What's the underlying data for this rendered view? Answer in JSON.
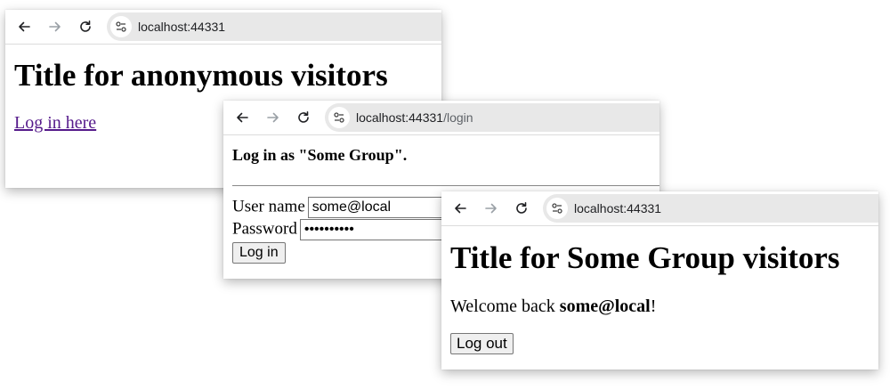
{
  "windows": {
    "anonymous": {
      "url_host": "localhost:44331",
      "url_path": "",
      "title": "Title for anonymous visitors",
      "login_link": "Log in here"
    },
    "login": {
      "url_host": "localhost:44331",
      "url_path": "/login",
      "heading": "Log in as \"Some Group\".",
      "username_label": "User name",
      "username_value": "some@local",
      "password_label": "Password",
      "password_value": "••••••••••",
      "submit_label": "Log in"
    },
    "group": {
      "url_host": "localhost:44331",
      "url_path": "",
      "title": "Title for Some Group visitors",
      "welcome_prefix": "Welcome back ",
      "welcome_user": "some@local",
      "welcome_suffix": "!",
      "logout_label": "Log out"
    }
  },
  "icons": {
    "back": "arrow-left-icon",
    "forward": "arrow-right-icon",
    "reload": "reload-icon",
    "site_info": "tune-icon"
  },
  "colors": {
    "link_visited": "#551a8b",
    "omnibox_bg": "#e8e8e8"
  }
}
